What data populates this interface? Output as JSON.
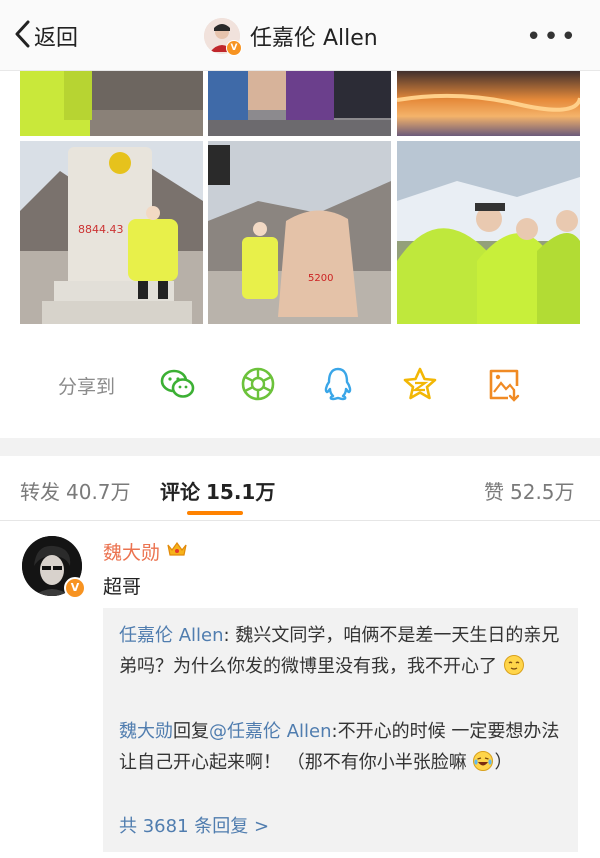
{
  "header": {
    "back_label": "返回",
    "title": "任嘉伦 Allen",
    "more_label": "•••"
  },
  "share": {
    "label": "分享到",
    "targets": [
      "wechat-icon",
      "moments-icon",
      "qq-icon",
      "qzone-icon",
      "save-image-icon"
    ]
  },
  "photos": {
    "stone_text": "8844.43",
    "marker_text": "5200"
  },
  "tabs": {
    "repost_label": "转发",
    "repost_count": "40.7万",
    "comment_label": "评论",
    "comment_count": "15.1万",
    "like_label": "赞",
    "like_count": "52.5万"
  },
  "comment": {
    "author": "魏大勋",
    "text": "超哥",
    "reply1_author": "任嘉伦 Allen",
    "reply1_text": ": 魏兴文同学，咱俩不是差一天生日的亲兄弟吗？为什么你发的微博里没有我，我不开心了",
    "reply2_author": "魏大勋",
    "reply2_mid": "回复",
    "reply2_mention": "@任嘉伦 Allen",
    "reply2_text": ":不开心的时候 一定要想办法让自己开心起来啊！ （那不有你小半张脸嘛",
    "reply2_tail": "）",
    "more_replies": "共 3681 条回复 >"
  },
  "colors": {
    "accent": "#ff8200",
    "name": "#eb7350",
    "link": "#507daf",
    "verified": "#f79321"
  }
}
